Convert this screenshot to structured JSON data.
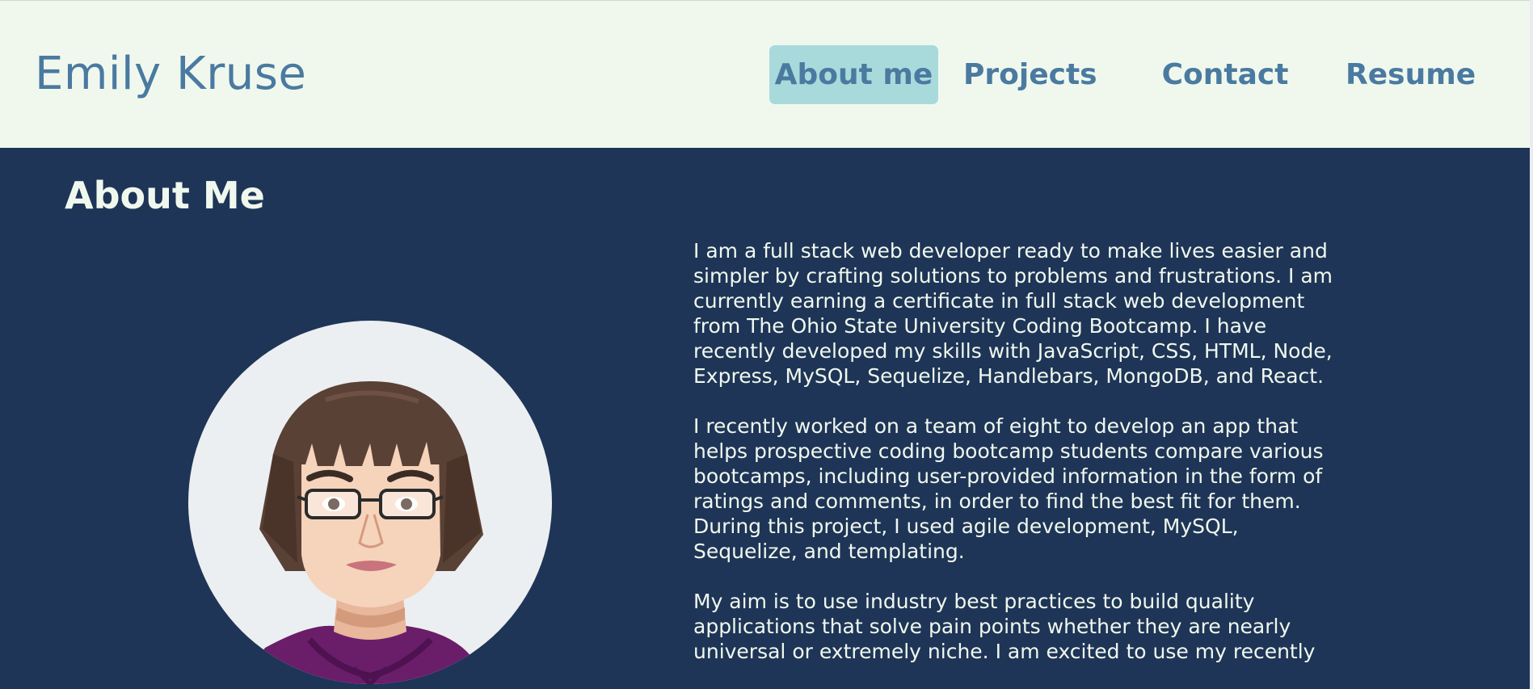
{
  "header": {
    "brand": "Emily Kruse",
    "nav": [
      {
        "label": "About me",
        "active": true
      },
      {
        "label": "Projects",
        "active": false
      },
      {
        "label": "Contact",
        "active": false
      },
      {
        "label": "Resume",
        "active": false
      }
    ]
  },
  "about": {
    "title": "About Me",
    "paragraphs": [
      "I am a full stack web developer ready to make lives easier and simpler by crafting solutions to problems and frustrations. I am currently earning a certificate in full stack web development from The Ohio State University Coding Bootcamp. I have recently developed my skills with JavaScript, CSS, HTML, Node, Express, MySQL, Sequelize, Handlebars, MongoDB, and React.",
      "I recently worked on a team of eight to develop an app that helps prospective coding bootcamp students compare various bootcamps, including user-provided information in the form of ratings and comments, in order to find the best fit for them. During this project, I used agile development, MySQL, Sequelize, and templating.",
      "My aim is to use industry best practices to build quality applications that solve pain points whether they are nearly universal or extremely niche. I am excited to use my recently"
    ]
  },
  "colors": {
    "header_bg": "#f0f8ee",
    "main_bg": "#1e3557",
    "accent": "#4a7aa0",
    "active_nav_bg": "#a8dadc",
    "text_light": "#f0f8ee"
  },
  "icons": {
    "avatar": "cartoon-woman-portrait"
  }
}
